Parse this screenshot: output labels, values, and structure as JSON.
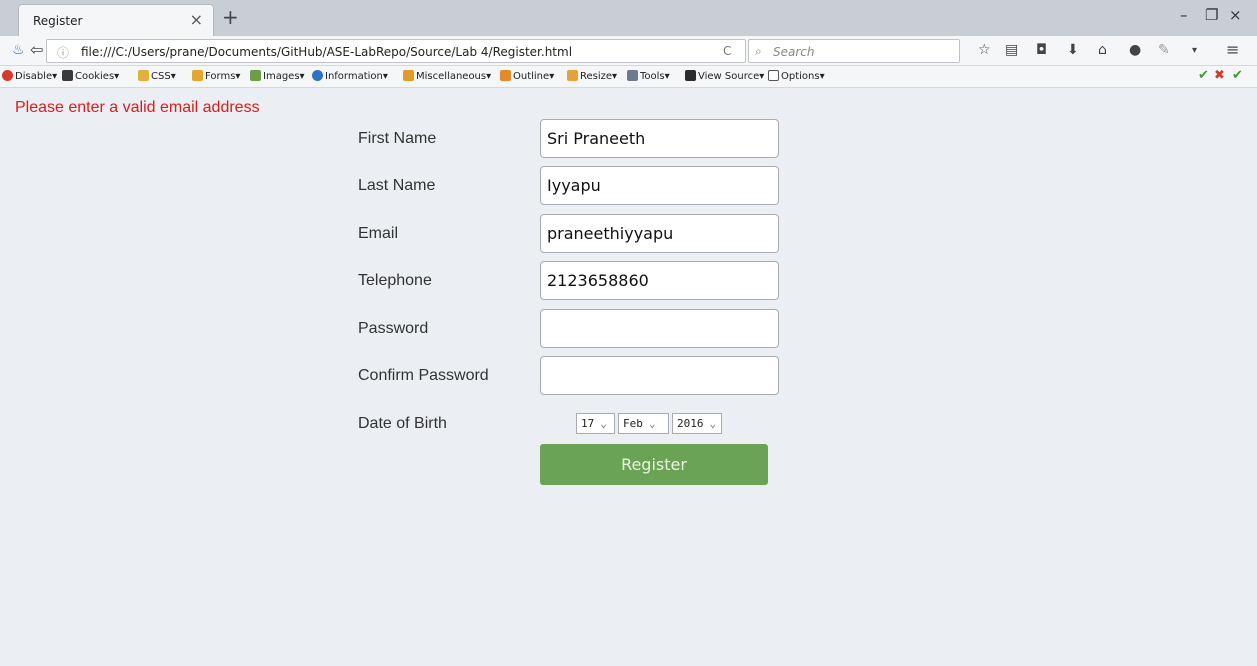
{
  "browser": {
    "tab_title": "Register",
    "tab_close": "×",
    "new_tab": "+",
    "window_controls": [
      "–",
      "❐",
      "×"
    ],
    "url": "file:///C:/Users/prane/Documents/GitHub/ASE-LabRepo/Source/Lab 4/Register.html",
    "search_placeholder": "Search",
    "reload": "C"
  },
  "devtoolbar": {
    "items": [
      "Disable",
      "Cookies",
      "CSS",
      "Forms",
      "Images",
      "Information",
      "Miscellaneous",
      "Outline",
      "Resize",
      "Tools",
      "View Source",
      "Options"
    ]
  },
  "page": {
    "error_message": "Please enter a valid email address",
    "labels": {
      "first_name": "First Name",
      "last_name": "Last Name",
      "email": "Email",
      "telephone": "Telephone",
      "password": "Password",
      "confirm_password": "Confirm Password",
      "dob": "Date of Birth"
    },
    "values": {
      "first_name": "Sri Praneeth",
      "last_name": "Iyyapu",
      "email": "praneethiyyapu",
      "telephone": "2123658860",
      "password": "",
      "confirm_password": ""
    },
    "dob": {
      "day": "17",
      "month": "Feb",
      "year": "2016"
    },
    "register_label": "Register"
  },
  "colors": {
    "error": "#e01b1b",
    "register_button": "#6aa356",
    "page_background": "#ebeef2"
  }
}
